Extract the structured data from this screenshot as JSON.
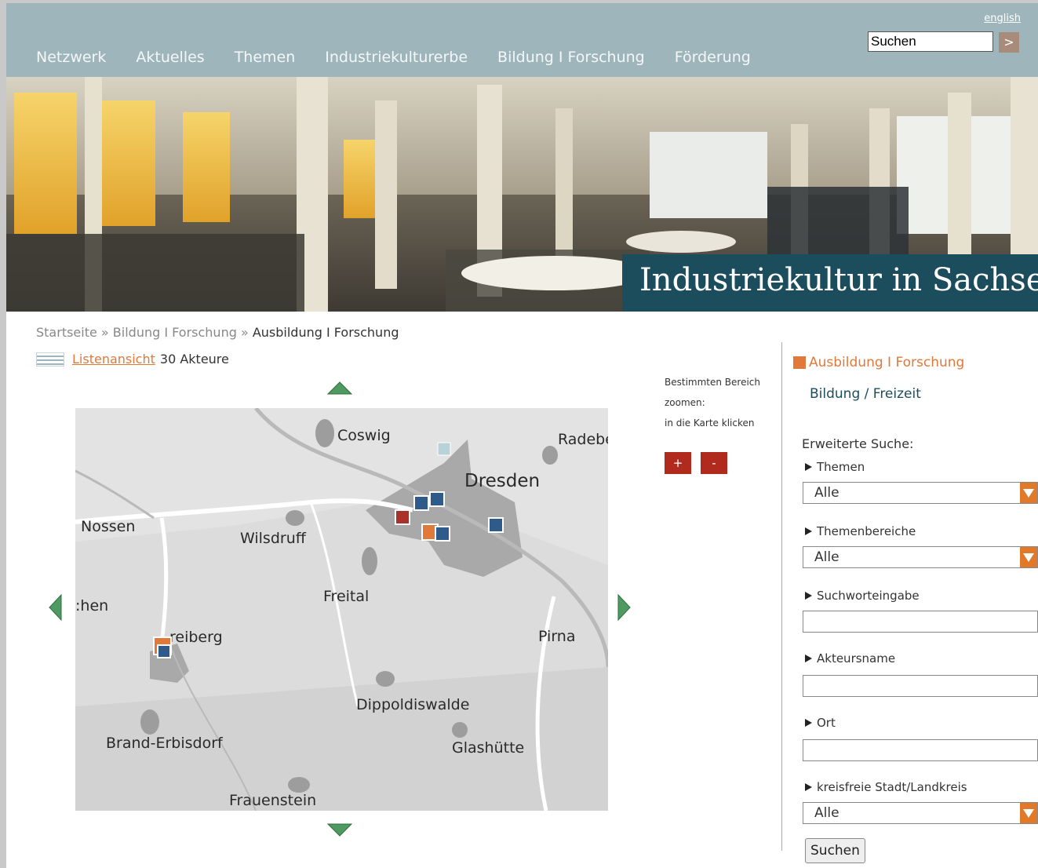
{
  "header": {
    "language_link": "english",
    "nav": [
      "Netzwerk",
      "Aktuelles",
      "Themen",
      "Industriekulturerbe",
      "Bildung I Forschung",
      "Förderung"
    ],
    "search_value": "Suchen",
    "search_go": ">"
  },
  "hero": {
    "title": "Industriekultur in Sachsen"
  },
  "breadcrumb": {
    "home": "Startseite",
    "sep1": " » ",
    "level1": "Bildung I Forschung",
    "sep2": " » ",
    "current": "Ausbildung I Forschung"
  },
  "list": {
    "link": "Listenansicht",
    "count": "30 Akteure"
  },
  "map": {
    "places": [
      "Coswig",
      "Radebe",
      "Dresden",
      "Nossen",
      "Wilsdruff",
      "Freital",
      ":hen",
      "reiberg",
      "Pirna",
      "Dippoldiswalde",
      "Brand-Erbisdorf",
      "Glashütte",
      "Frauenstein"
    ]
  },
  "zoom": {
    "help_line1": "Bestimmten Bereich",
    "help_line2": "zoomen:",
    "help_line3": "in die Karte klicken",
    "plus": "+",
    "minus": "-"
  },
  "sidebar": {
    "active_category": "Ausbildung I Forschung",
    "category2": "Bildung / Freizeit",
    "advanced": "Erweiterte Suche:",
    "themen_label": "Themen",
    "themen_value": "Alle",
    "themenbereiche_label": "Themenbereiche",
    "themenbereiche_value": "Alle",
    "suchwort_label": "Suchworteingabe",
    "akteur_label": "Akteursname",
    "ort_label": "Ort",
    "kreis_label": "kreisfreie Stadt/Landkreis",
    "kreis_value": "Alle",
    "submit": "Suchen"
  },
  "colors": {
    "accent_orange": "#e0793a",
    "header_bg": "#9fb5bc",
    "title_bg": "#1c4d5d",
    "zoom_red": "#b02a1e"
  }
}
